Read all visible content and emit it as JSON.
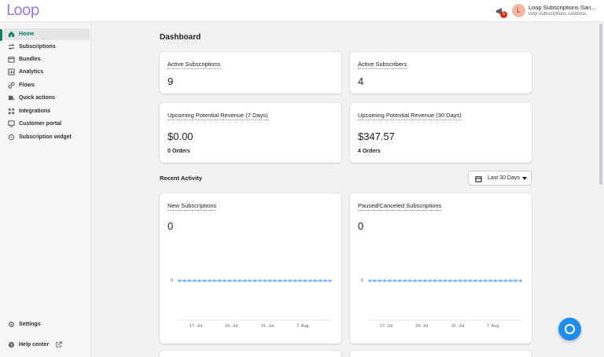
{
  "app": {
    "logo_text": "Loop"
  },
  "topbar": {
    "notification_count": "5",
    "avatar_initial": "L",
    "store_name": "Loop Subscriptions San...",
    "store_url": "loop-subscriptions-sandbox..."
  },
  "sidebar": {
    "items": [
      {
        "label": "Home",
        "icon": "home-icon",
        "active": true
      },
      {
        "label": "Subscriptions",
        "icon": "repeat-icon"
      },
      {
        "label": "Bundles",
        "icon": "bundle-icon"
      },
      {
        "label": "Analytics",
        "icon": "analytics-icon"
      },
      {
        "label": "Flows",
        "icon": "flows-icon"
      },
      {
        "label": "Quick actions",
        "icon": "quick-actions-icon"
      },
      {
        "label": "Integrations",
        "icon": "integrations-icon"
      },
      {
        "label": "Customer portal",
        "icon": "customer-portal-icon"
      },
      {
        "label": "Subscription widget",
        "icon": "widget-icon"
      }
    ],
    "settings_label": "Settings",
    "help_label": "Help center"
  },
  "dashboard": {
    "title": "Dashboard",
    "active_subscriptions": {
      "label": "Active Subscriptions",
      "value": "9"
    },
    "active_subscribers": {
      "label": "Active Subscribers",
      "value": "4"
    },
    "revenue_7": {
      "label": "Upcoming Potential Revenue (7 Days)",
      "value": "$0.00",
      "orders": "0 Orders"
    },
    "revenue_30": {
      "label": "Upcoming Potential Revenue (30 Days)",
      "value": "$347.57",
      "orders": "4 Orders"
    },
    "recent_activity_label": "Recent Activity",
    "range_label": "Last 30 Days",
    "new_subscriptions": {
      "label": "New Subscriptions",
      "value": "0"
    },
    "paused_canceled": {
      "label": "Paused/Canceled Subscriptions",
      "value": "0"
    }
  },
  "colors": {
    "accent": "#008060",
    "series": "#7cb5ec",
    "fab": "#1f8ded",
    "logo": "#9b7ae0"
  },
  "chart_data": [
    {
      "type": "line",
      "title": "New Subscriptions",
      "ylabel": "",
      "xlabel": "",
      "y_ticks": [
        "0"
      ],
      "x_ticks": [
        "17. Jul",
        "24. Jul",
        "31. Jul",
        "7. Aug"
      ],
      "series": [
        {
          "values": [
            0,
            0,
            0,
            0,
            0,
            0,
            0,
            0,
            0,
            0,
            0,
            0,
            0,
            0,
            0,
            0,
            0,
            0,
            0,
            0,
            0,
            0,
            0,
            0,
            0,
            0,
            0,
            0,
            0,
            0,
            0
          ]
        }
      ]
    },
    {
      "type": "line",
      "title": "Paused/Canceled Subscriptions",
      "ylabel": "",
      "xlabel": "",
      "y_ticks": [
        "0"
      ],
      "x_ticks": [
        "17. Jul",
        "24. Jul",
        "31. Jul",
        "7. Aug"
      ],
      "series": [
        {
          "values": [
            0,
            0,
            0,
            0,
            0,
            0,
            0,
            0,
            0,
            0,
            0,
            0,
            0,
            0,
            0,
            0,
            0,
            0,
            0,
            0,
            0,
            0,
            0,
            0,
            0,
            0,
            0,
            0,
            0,
            0,
            0
          ]
        }
      ]
    }
  ]
}
